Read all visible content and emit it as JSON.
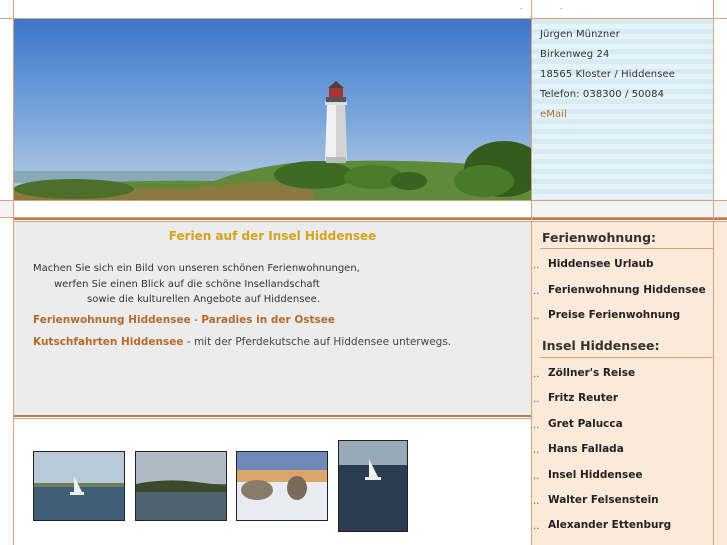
{
  "top_strip": {
    "marks": [
      "-",
      "-"
    ]
  },
  "header": {
    "image_name": "Lighthouse Dornbusch Hiddensee"
  },
  "contact": {
    "name": "Jürgen Münzner",
    "street": "Birkenweg 24",
    "city": "18565 Kloster / Hiddensee",
    "phone": "Telefon: 038300 / 50084",
    "email_label": "eMail"
  },
  "main": {
    "title": "Ferien auf der Insel Hiddensee",
    "intro": [
      "Machen Sie sich ein Bild von unseren schönen Ferienwohnungen,",
      "werfen Sie einen Blick auf die schöne Insellandschaft",
      "sowie die kulturellen Angebote auf Hiddensee."
    ],
    "link_row_1": {
      "link_a": "Ferienwohnung Hiddensee",
      "separator": " - ",
      "link_b": "Paradies in der Ostsee"
    },
    "link_row_2": {
      "link_a": "Kutschfahrten Hiddensee",
      "text": " - mit der Pferdekutsche auf Hiddensee unterwegs."
    }
  },
  "gallery": {
    "thumbs": [
      "sailboat-sea",
      "coast-evening",
      "snowy-winter",
      "sailboat-dark-sea"
    ]
  },
  "sidebar": {
    "bullet": "..",
    "section_1": {
      "heading": "Ferienwohnung:",
      "items": [
        "Hiddensee Urlaub",
        "Ferienwohnung Hiddensee",
        "Preise Ferienwohnung"
      ]
    },
    "section_2": {
      "heading": "Insel Hiddensee:",
      "items": [
        "Zöllner's Reise",
        "Fritz Reuter",
        "Gret Palucca",
        "Hans Fallada",
        "Insel Hiddensee",
        "Walter Felsenstein",
        "Alexander Ettenburg"
      ]
    }
  },
  "colors": {
    "accent_gold": "#d4a21b",
    "link_brown": "#b56a2a",
    "rule_brown": "#b87a4e",
    "sidebar_bg": "#fbead9",
    "contact_bg": "#d5ecf5"
  }
}
